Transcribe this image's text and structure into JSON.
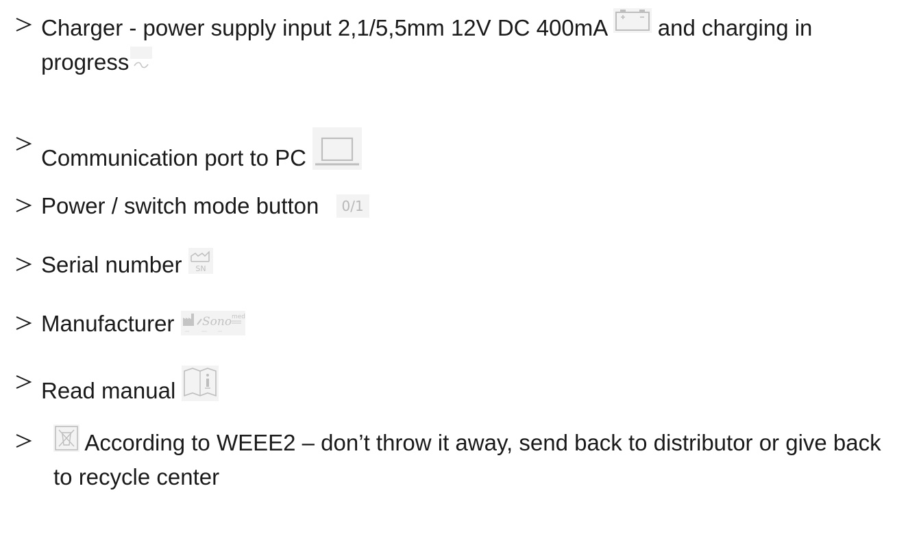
{
  "items": [
    {
      "text_before": "Charger - power supply input 2,1/5,5mm 12V DC 400mA ",
      "icon": "battery-icon",
      "text_middle": " and charging in progress",
      "icon2": "ac-wave-icon"
    },
    {
      "text_before": "Communication port to PC ",
      "icon": "laptop-icon"
    },
    {
      "text_before": "Power / switch mode button ",
      "icon": "power-switch-icon",
      "icon_text": "0/1"
    },
    {
      "text_before": "Serial number ",
      "icon": "serial-number-icon",
      "icon_text": "SN"
    },
    {
      "text_before": "Manufacturer ",
      "icon": "manufacturer-icon",
      "icon_text": "Sono",
      "icon_sup": "med"
    },
    {
      "text_before": "Read manual ",
      "icon": "read-manual-icon"
    },
    {
      "icon": "weee-crossed-bin-icon",
      "text_after": " According to WEEE2 – don’t throw it away, send back to distributor or give back to recycle center"
    }
  ],
  "colors": {
    "text": "#1a1a1a",
    "symbol_bg": "#f3f3f3",
    "symbol_stroke": "#bdbdbd"
  }
}
